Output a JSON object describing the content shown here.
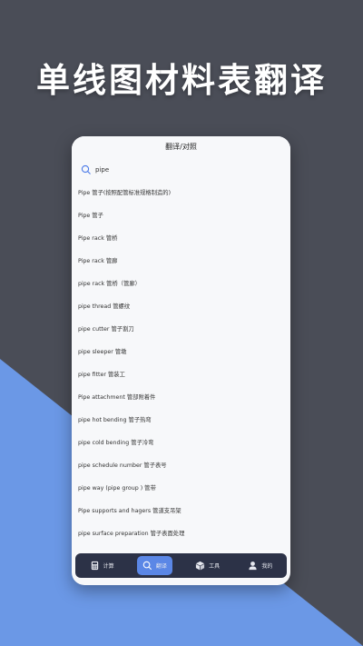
{
  "banner": {
    "headline": "单线图材料表翻译"
  },
  "app": {
    "title": "翻译/对照",
    "search": {
      "value": "pipe",
      "placeholder": ""
    },
    "results": [
      "Pipe 管子(按照配管标准规格制造的)",
      "Pipe 管子",
      "Pipe rack 管桥",
      "Pipe rack 管廊",
      "pipe rack 管桥（管廊）",
      "pipe thread 管螺纹",
      "pipe cutter 管子割刀",
      "pipe sleeper 管墩",
      "pipe fitter 管装工",
      "Pipe attachment 管部附着件",
      "pipe hot bending 管子热弯",
      "pipe cold bending 管子冷弯",
      "pipe schedule number 管子表号",
      "pipe way (pipe group ) 管带",
      "Pipe supports and hagers 管道支吊架",
      "pipe surface preparation 管子表面处理"
    ],
    "tabs": [
      {
        "label": "计算",
        "icon": "calculator-icon",
        "active": false
      },
      {
        "label": "翻译",
        "icon": "search-icon",
        "active": true
      },
      {
        "label": "工具",
        "icon": "cube-icon",
        "active": false
      },
      {
        "label": "我的",
        "icon": "user-icon",
        "active": false
      }
    ]
  },
  "colors": {
    "background": "#4a4d57",
    "accent_triangle": "#6b98e6",
    "tab_active": "#5b87e6",
    "tabbar": "#2c3247"
  }
}
